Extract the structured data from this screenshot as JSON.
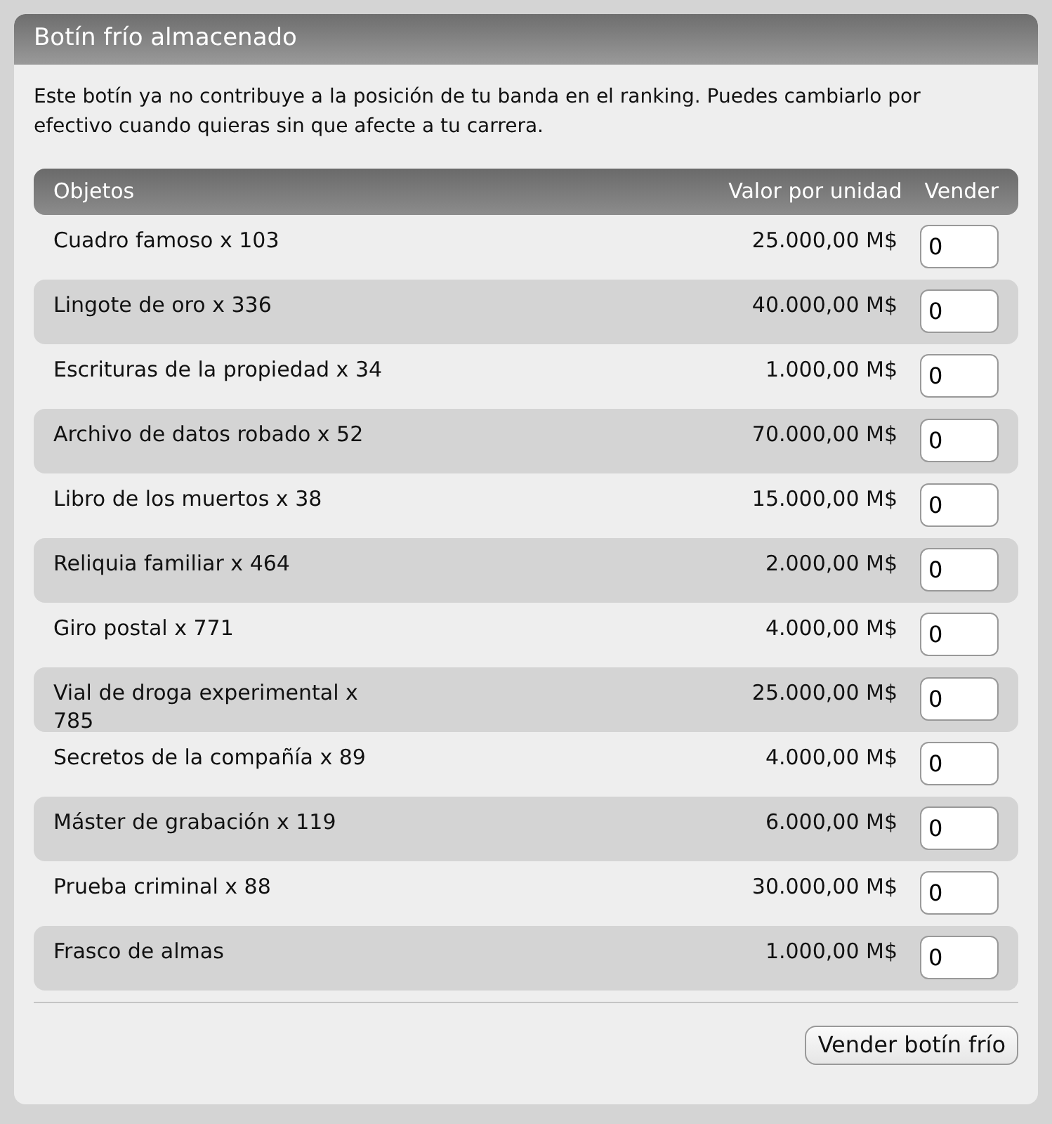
{
  "panel": {
    "title": "Botín frío almacenado",
    "description": "Este botín ya no contribuye a la posición de tu banda en el ranking. Puedes cambiarlo por efectivo cuando quieras sin que afecte a tu carrera."
  },
  "table": {
    "columns": [
      "Objetos",
      "Valor por unidad",
      "Vender"
    ],
    "rows": [
      {
        "item": "Cuadro famoso x 103",
        "value": "25.000,00 M$",
        "sell": "0"
      },
      {
        "item": "Lingote de oro x 336",
        "value": "40.000,00 M$",
        "sell": "0"
      },
      {
        "item": "Escrituras de la propiedad x 34",
        "value": "1.000,00 M$",
        "sell": "0"
      },
      {
        "item": "Archivo de datos robado x 52",
        "value": "70.000,00 M$",
        "sell": "0"
      },
      {
        "item": "Libro de los muertos x 38",
        "value": "15.000,00 M$",
        "sell": "0"
      },
      {
        "item": "Reliquia familiar x 464",
        "value": "2.000,00 M$",
        "sell": "0"
      },
      {
        "item": "Giro postal x 771",
        "value": "4.000,00 M$",
        "sell": "0"
      },
      {
        "item": "Vial de droga experimental x 785",
        "value": "25.000,00 M$",
        "sell": "0"
      },
      {
        "item": "Secretos de la compañía x 89",
        "value": "4.000,00 M$",
        "sell": "0"
      },
      {
        "item": "Máster de grabación x 119",
        "value": "6.000,00 M$",
        "sell": "0"
      },
      {
        "item": "Prueba criminal x 88",
        "value": "30.000,00 M$",
        "sell": "0"
      },
      {
        "item": "Frasco de almas",
        "value": "1.000,00 M$",
        "sell": "0"
      }
    ]
  },
  "submit_button": "Vender botín frío"
}
